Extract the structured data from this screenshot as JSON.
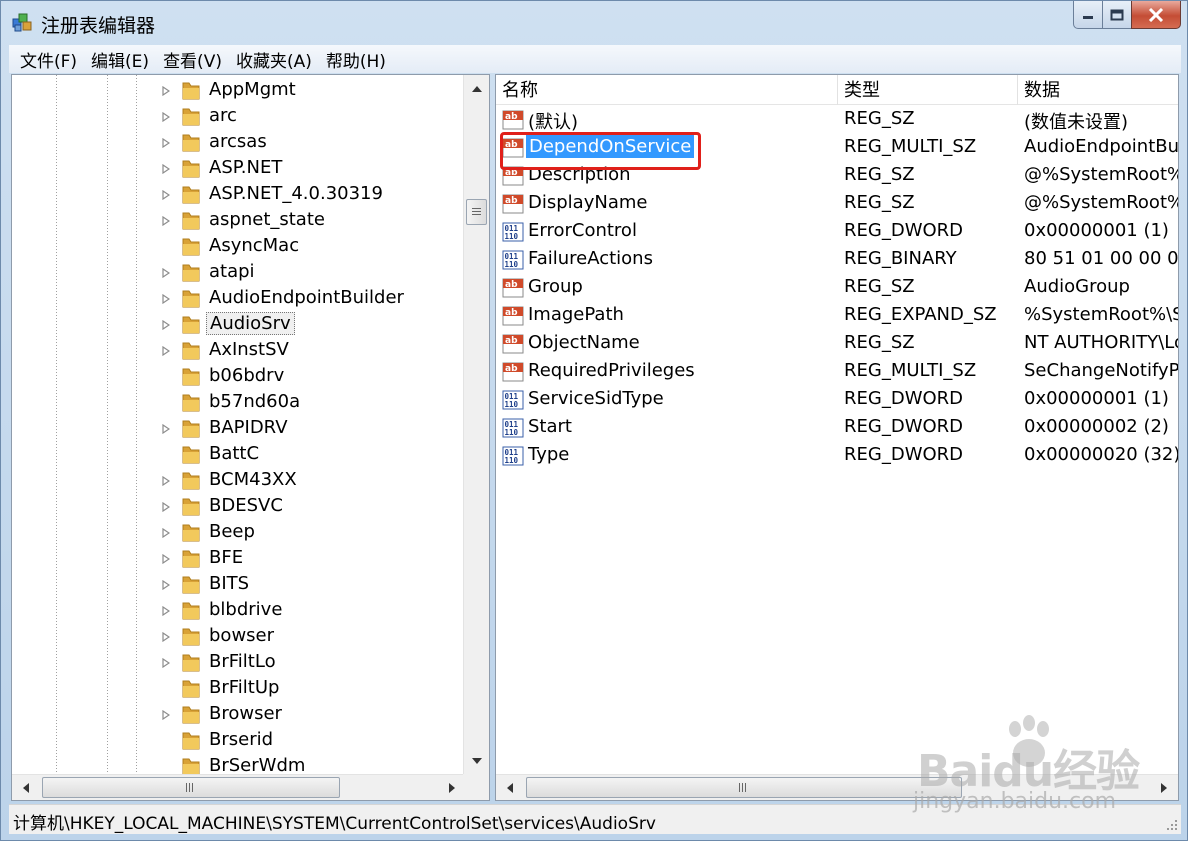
{
  "window": {
    "title": "注册表编辑器",
    "controls": {
      "minimize": "minimize",
      "maximize": "maximize",
      "close": "close"
    }
  },
  "menu": [
    {
      "label": "文件(F)"
    },
    {
      "label": "编辑(E)"
    },
    {
      "label": "查看(V)"
    },
    {
      "label": "收藏夹(A)"
    },
    {
      "label": "帮助(H)"
    }
  ],
  "tree": {
    "items": [
      {
        "label": "AppMgmt",
        "expandable": true
      },
      {
        "label": "arc",
        "expandable": true
      },
      {
        "label": "arcsas",
        "expandable": true
      },
      {
        "label": "ASP.NET",
        "expandable": true
      },
      {
        "label": "ASP.NET_4.0.30319",
        "expandable": true
      },
      {
        "label": "aspnet_state",
        "expandable": true
      },
      {
        "label": "AsyncMac",
        "expandable": false
      },
      {
        "label": "atapi",
        "expandable": true
      },
      {
        "label": "AudioEndpointBuilder",
        "expandable": true
      },
      {
        "label": "AudioSrv",
        "expandable": true,
        "selected": true
      },
      {
        "label": "AxInstSV",
        "expandable": true
      },
      {
        "label": "b06bdrv",
        "expandable": false
      },
      {
        "label": "b57nd60a",
        "expandable": false
      },
      {
        "label": "BAPIDRV",
        "expandable": true
      },
      {
        "label": "BattC",
        "expandable": false
      },
      {
        "label": "BCM43XX",
        "expandable": true
      },
      {
        "label": "BDESVC",
        "expandable": true
      },
      {
        "label": "Beep",
        "expandable": true
      },
      {
        "label": "BFE",
        "expandable": true
      },
      {
        "label": "BITS",
        "expandable": true
      },
      {
        "label": "blbdrive",
        "expandable": true
      },
      {
        "label": "bowser",
        "expandable": true
      },
      {
        "label": "BrFiltLo",
        "expandable": true
      },
      {
        "label": "BrFiltUp",
        "expandable": false
      },
      {
        "label": "Browser",
        "expandable": true
      },
      {
        "label": "Brserid",
        "expandable": false
      },
      {
        "label": "BrSerWdm",
        "expandable": false
      }
    ]
  },
  "list": {
    "columns": [
      {
        "label": "名称"
      },
      {
        "label": "类型"
      },
      {
        "label": "数据"
      }
    ],
    "rows": [
      {
        "name": "(默认)",
        "type": "REG_SZ",
        "data": "(数值未设置)",
        "icon": "ab"
      },
      {
        "name": "DependOnService",
        "type": "REG_MULTI_SZ",
        "data": "AudioEndpointBu",
        "icon": "ab",
        "selected": true
      },
      {
        "name": "Description",
        "type": "REG_SZ",
        "data": "@%SystemRoot%",
        "icon": "ab"
      },
      {
        "name": "DisplayName",
        "type": "REG_SZ",
        "data": "@%SystemRoot%",
        "icon": "ab"
      },
      {
        "name": "ErrorControl",
        "type": "REG_DWORD",
        "data": "0x00000001 (1)",
        "icon": "bin"
      },
      {
        "name": "FailureActions",
        "type": "REG_BINARY",
        "data": "80 51 01 00 00 00",
        "icon": "bin"
      },
      {
        "name": "Group",
        "type": "REG_SZ",
        "data": "AudioGroup",
        "icon": "ab"
      },
      {
        "name": "ImagePath",
        "type": "REG_EXPAND_SZ",
        "data": "%SystemRoot%\\S",
        "icon": "ab"
      },
      {
        "name": "ObjectName",
        "type": "REG_SZ",
        "data": "NT AUTHORITY\\Lo",
        "icon": "ab"
      },
      {
        "name": "RequiredPrivileges",
        "type": "REG_MULTI_SZ",
        "data": "SeChangeNotifyP",
        "icon": "ab"
      },
      {
        "name": "ServiceSidType",
        "type": "REG_DWORD",
        "data": "0x00000001 (1)",
        "icon": "bin"
      },
      {
        "name": "Start",
        "type": "REG_DWORD",
        "data": "0x00000002 (2)",
        "icon": "bin"
      },
      {
        "name": "Type",
        "type": "REG_DWORD",
        "data": "0x00000020 (32)",
        "icon": "bin"
      }
    ]
  },
  "statusbar": {
    "path": "计算机\\HKEY_LOCAL_MACHINE\\SYSTEM\\CurrentControlSet\\services\\AudioSrv"
  },
  "watermark": {
    "brand": "Baidu经验",
    "url": "jingyan.baidu.com"
  },
  "colors": {
    "selection": "#3399ff",
    "highlight_box": "#e0201a",
    "folder": "#e8b94a"
  }
}
